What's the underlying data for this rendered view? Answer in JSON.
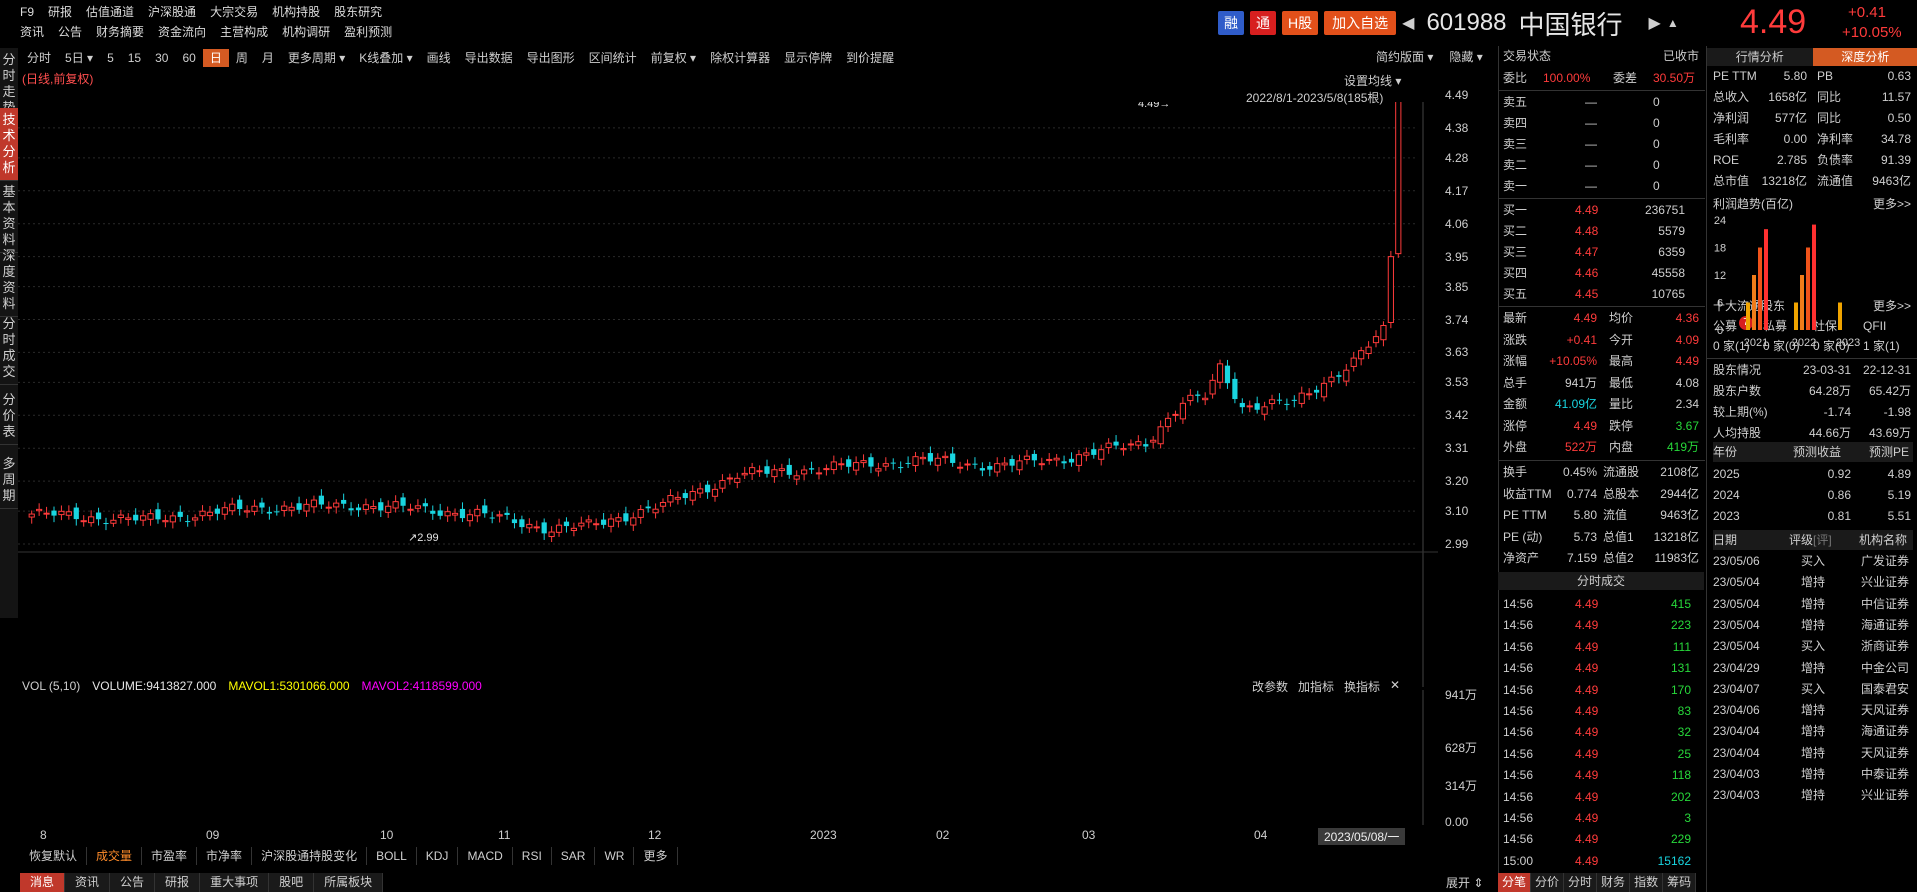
{
  "nav": {
    "row1": [
      "F9",
      "研报",
      "估值通道",
      "沪深股通",
      "大宗交易",
      "机构持股",
      "股东研究"
    ],
    "row2": [
      "资讯",
      "公告",
      "财务摘要",
      "资金流向",
      "主营构成",
      "机构调研",
      "盈利预测"
    ]
  },
  "header": {
    "tags": [
      "融",
      "通",
      "H股",
      "加入自选"
    ],
    "code": "601988",
    "name": "中国银行",
    "price": "4.49",
    "change": "+0.41",
    "change_pct": "+10.05%"
  },
  "left_tabs": [
    "分时走势",
    "技术分析",
    "基本资料",
    "深度资料",
    "分时成交",
    "分价表",
    "多周期"
  ],
  "toolbar": {
    "items": [
      "分时",
      "5日",
      "5",
      "15",
      "30",
      "60",
      "日",
      "周",
      "月",
      "更多周期",
      "K线叠加",
      "画线",
      "导出数据",
      "导出图形",
      "区间统计",
      "前复权",
      "除权计算器",
      "显示停牌",
      "到价提醒"
    ],
    "active": "日",
    "right": [
      "简约版面",
      "隐藏"
    ]
  },
  "chart_info": {
    "subtitle": "(日线,前复权)",
    "ma_setting": "设置均线",
    "date_range": "2022/8/1-2023/5/8(185根)",
    "max_label": "4.49",
    "min_label": "2.99"
  },
  "chart_data": {
    "type": "candlestick",
    "y_ticks": [
      "4.49",
      "4.38",
      "4.28",
      "4.17",
      "4.06",
      "3.95",
      "3.85",
      "3.74",
      "3.63",
      "3.53",
      "3.42",
      "3.31",
      "3.20",
      "3.10",
      "2.99"
    ],
    "x_ticks": [
      "8",
      "09",
      "10",
      "11",
      "12",
      "2023",
      "02",
      "03",
      "04"
    ],
    "ylim": [
      2.99,
      4.49
    ],
    "close_anchors": [
      [
        0,
        3.09
      ],
      [
        15,
        3.07
      ],
      [
        30,
        3.11
      ],
      [
        45,
        3.12
      ],
      [
        60,
        3.09
      ],
      [
        70,
        3.04
      ],
      [
        75,
        3.05
      ],
      [
        85,
        3.12
      ],
      [
        95,
        3.22
      ],
      [
        110,
        3.25
      ],
      [
        120,
        3.27
      ],
      [
        130,
        3.25
      ],
      [
        140,
        3.28
      ],
      [
        150,
        3.33
      ],
      [
        155,
        3.46
      ],
      [
        158,
        3.48
      ],
      [
        160,
        3.58
      ],
      [
        163,
        3.45
      ],
      [
        170,
        3.46
      ],
      [
        178,
        3.6
      ],
      [
        182,
        3.7
      ],
      [
        183,
        3.95
      ],
      [
        184,
        4.49
      ]
    ],
    "volume": {
      "label": "VOL (5,10)",
      "volume": "VOLUME:9413827.000",
      "mavol1": "MAVOL1:5301066.000",
      "mavol2": "MAVOL2:4118599.000",
      "ticks": [
        "941万",
        "628万",
        "314万",
        "0.00"
      ],
      "tools": [
        "改参数",
        "加指标",
        "换指标"
      ]
    }
  },
  "x_cursor": "2023/05/08/一",
  "indicator_tabs": [
    "恢复默认",
    "成交量",
    "市盈率",
    "市净率",
    "沪深股通持股变化",
    "BOLL",
    "KDJ",
    "MACD",
    "RSI",
    "SAR",
    "WR",
    "更多"
  ],
  "bottom_tabs": [
    "消息",
    "资讯",
    "公告",
    "研报",
    "重大事项",
    "股吧",
    "所属板块"
  ],
  "expand": "展开",
  "orderbook": {
    "status_label": "交易状态",
    "status_value": "已收市",
    "weibi_label": "委比",
    "weibi_value": "100.00%",
    "weicha_label": "委差",
    "weicha_value": "30.50万",
    "asks": [
      [
        "卖五",
        "—",
        "0"
      ],
      [
        "卖四",
        "—",
        "0"
      ],
      [
        "卖三",
        "—",
        "0"
      ],
      [
        "卖二",
        "—",
        "0"
      ],
      [
        "卖一",
        "—",
        "0"
      ]
    ],
    "bids": [
      [
        "买一",
        "4.49",
        "236751"
      ],
      [
        "买二",
        "4.48",
        "5579"
      ],
      [
        "买三",
        "4.47",
        "6359"
      ],
      [
        "买四",
        "4.46",
        "45558"
      ],
      [
        "买五",
        "4.45",
        "10765"
      ]
    ],
    "stats": [
      [
        "最新",
        "4.49",
        "均价",
        "4.36"
      ],
      [
        "涨跌",
        "+0.41",
        "今开",
        "4.09"
      ],
      [
        "涨幅",
        "+10.05%",
        "最高",
        "4.49"
      ],
      [
        "总手",
        "941万",
        "最低",
        "4.08"
      ],
      [
        "金额",
        "41.09亿",
        "量比",
        "2.34"
      ],
      [
        "涨停",
        "4.49",
        "跌停",
        "3.67"
      ],
      [
        "外盘",
        "522万",
        "内盘",
        "419万"
      ]
    ],
    "stats2": [
      [
        "换手",
        "0.45%",
        "流通股",
        "2108亿"
      ],
      [
        "收益TTM",
        "0.774",
        "总股本",
        "2944亿"
      ],
      [
        "PE TTM",
        "5.80",
        "流值",
        "9463亿"
      ],
      [
        "PE (动)",
        "5.73",
        "总值1",
        "13218亿"
      ],
      [
        "净资产",
        "7.159",
        "总值2",
        "11983亿"
      ]
    ]
  },
  "trades": {
    "title": "分时成交",
    "rows": [
      [
        "14:56",
        "4.49",
        "415"
      ],
      [
        "14:56",
        "4.49",
        "223"
      ],
      [
        "14:56",
        "4.49",
        "111"
      ],
      [
        "14:56",
        "4.49",
        "131"
      ],
      [
        "14:56",
        "4.49",
        "170"
      ],
      [
        "14:56",
        "4.49",
        "83"
      ],
      [
        "14:56",
        "4.49",
        "32"
      ],
      [
        "14:56",
        "4.49",
        "25"
      ],
      [
        "14:56",
        "4.49",
        "118"
      ],
      [
        "14:56",
        "4.49",
        "202"
      ],
      [
        "14:56",
        "4.49",
        "3"
      ],
      [
        "14:56",
        "4.49",
        "229"
      ],
      [
        "15:00",
        "4.49",
        "15162"
      ]
    ]
  },
  "right_bottom_tabs": [
    "分笔",
    "分价",
    "分时",
    "财务",
    "指数",
    "筹码"
  ],
  "fundamentals": {
    "tabs": [
      "行情分析",
      "深度分析"
    ],
    "rows": [
      [
        "PE TTM",
        "5.80",
        "PB",
        "0.63"
      ],
      [
        "总收入",
        "1658亿",
        "同比",
        "11.57"
      ],
      [
        "净利润",
        "577亿",
        "同比",
        "0.50"
      ],
      [
        "毛利率",
        "0.00",
        "净利率",
        "34.78"
      ],
      [
        "ROE",
        "2.785",
        "负债率",
        "91.39"
      ],
      [
        "总市值",
        "13218亿",
        "流通值",
        "9463亿"
      ]
    ],
    "profit_title": "利润趋势(百亿)",
    "more": "更多>>",
    "profit_chart": {
      "type": "bar",
      "y_ticks": [
        "24",
        "18",
        "12",
        "6",
        "0"
      ],
      "years": [
        "2021",
        "2022",
        "2023"
      ],
      "values": [
        [
          6,
          12,
          18,
          22
        ],
        [
          6,
          12,
          18,
          23
        ],
        [
          6
        ]
      ]
    },
    "top10_title": "十大流通股东",
    "top10_tabs": [
      "公募",
      "私募",
      "社保",
      "QFII"
    ],
    "top10_badge": "7",
    "top10_values": [
      "0 家(1)",
      "0 家(0)",
      "0 家(0)",
      "1 家(1)"
    ],
    "holder_rows": [
      [
        "股东情况",
        "23-03-31",
        "22-12-31"
      ],
      [
        "股东户数",
        "64.28万",
        "65.42万"
      ],
      [
        "较上期(%)",
        "-1.74",
        "-1.98"
      ],
      [
        "人均持股",
        "44.66万",
        "43.69万"
      ]
    ],
    "forecast_head": [
      "年份",
      "预测收益",
      "预测PE"
    ],
    "forecast_rows": [
      [
        "2025",
        "0.92",
        "4.89"
      ],
      [
        "2024",
        "0.86",
        "5.19"
      ],
      [
        "2023",
        "0.81",
        "5.51"
      ]
    ],
    "ratings_head": [
      "日期",
      "评级",
      "机构名称"
    ],
    "ratings_head_note": "[评]",
    "ratings": [
      [
        "23/05/06",
        "买入",
        "广发证券"
      ],
      [
        "23/05/04",
        "增持",
        "兴业证券"
      ],
      [
        "23/05/04",
        "增持",
        "中信证券"
      ],
      [
        "23/05/04",
        "增持",
        "海通证券"
      ],
      [
        "23/05/04",
        "买入",
        "浙商证券"
      ],
      [
        "23/04/29",
        "增持",
        "中金公司"
      ],
      [
        "23/04/07",
        "买入",
        "国泰君安"
      ],
      [
        "23/04/06",
        "增持",
        "天风证券"
      ],
      [
        "23/04/04",
        "增持",
        "海通证券"
      ],
      [
        "23/04/04",
        "增持",
        "天风证券"
      ],
      [
        "23/04/03",
        "增持",
        "中泰证券"
      ],
      [
        "23/04/03",
        "增持",
        "兴业证券"
      ]
    ]
  },
  "colors": {
    "up": "#ff3b3b",
    "down": "#19d5e0",
    "accent": "#d45a22",
    "ma1": "#ffff00",
    "ma2": "#ff00ff"
  }
}
